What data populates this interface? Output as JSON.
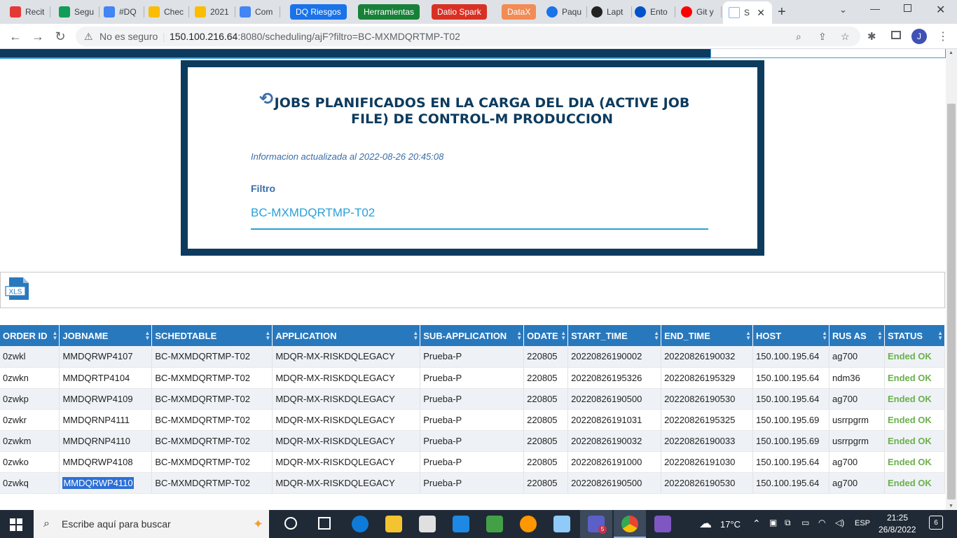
{
  "browser": {
    "tabs": [
      {
        "label": "Recit",
        "icon": "calendar-icon",
        "color": "#e53935"
      },
      {
        "label": "Segu",
        "icon": "sheets-icon",
        "color": "#0f9d58"
      },
      {
        "label": "#DQ",
        "icon": "docs-icon",
        "color": "#4285f4"
      },
      {
        "label": "Chec",
        "icon": "drive-icon",
        "color": "#fbbc04"
      },
      {
        "label": "2021",
        "icon": "drive-icon",
        "color": "#fbbc04"
      },
      {
        "label": "Com",
        "icon": "docs-icon",
        "color": "#4285f4"
      }
    ],
    "bookmarks": [
      {
        "label": "DQ Riesgos",
        "color": "#1a73e8"
      },
      {
        "label": "Herramientas",
        "color": "#188038"
      },
      {
        "label": "Datio Spark",
        "color": "#d93025"
      },
      {
        "label": "DataX",
        "color": "#f28b54"
      }
    ],
    "tabs2": [
      {
        "label": "Paqu",
        "icon": "pin-icon",
        "color": "#1a73e8"
      },
      {
        "label": "Lapt",
        "icon": "circle-icon",
        "color": "#222"
      },
      {
        "label": "Ento",
        "icon": "atlassian-icon",
        "color": "#0052cc"
      },
      {
        "label": "Git y",
        "icon": "youtube-icon",
        "color": "#ff0000"
      }
    ],
    "active_tab": "S",
    "security_label": "No es seguro",
    "url_host": "150.100.216.64",
    "url_rest": ":8080/scheduling/ajF?filtro=BC-MXMDQRTMP-T02",
    "profile_initial": "J"
  },
  "page": {
    "title": "JOBS PLANIFICADOS EN LA CARGA DEL DIA (ACTIVE JOB FILE) DE CONTROL-M PRODUCCION",
    "updated": "Informacion actualizada al 2022-08-26 20:45:08",
    "filter_label": "Filtro",
    "filter_value": "BC-MXMDQRTMP-T02",
    "xls_label": "XLS"
  },
  "table": {
    "columns": [
      "ORDER ID",
      "JOBNAME",
      "SCHEDTABLE",
      "APPLICATION",
      "SUB-APPLICATION",
      "ODATE",
      "START_TIME",
      "END_TIME",
      "HOST",
      "RUS AS",
      "STATUS"
    ],
    "rows": [
      [
        "0zwkl",
        "MMDQRWP4107",
        "BC-MXMDQRTMP-T02",
        "MDQR-MX-RISKDQLEGACY",
        "Prueba-P",
        "220805",
        "20220826190002",
        "20220826190032",
        "150.100.195.64",
        "ag700",
        "Ended OK"
      ],
      [
        "0zwkn",
        "MMDQRTP4104",
        "BC-MXMDQRTMP-T02",
        "MDQR-MX-RISKDQLEGACY",
        "Prueba-P",
        "220805",
        "20220826195326",
        "20220826195329",
        "150.100.195.64",
        "ndm36",
        "Ended OK"
      ],
      [
        "0zwkp",
        "MMDQRWP4109",
        "BC-MXMDQRTMP-T02",
        "MDQR-MX-RISKDQLEGACY",
        "Prueba-P",
        "220805",
        "20220826190500",
        "20220826190530",
        "150.100.195.64",
        "ag700",
        "Ended OK"
      ],
      [
        "0zwkr",
        "MMDQRNP4111",
        "BC-MXMDQRTMP-T02",
        "MDQR-MX-RISKDQLEGACY",
        "Prueba-P",
        "220805",
        "20220826191031",
        "20220826195325",
        "150.100.195.69",
        "usrrpgrm",
        "Ended OK"
      ],
      [
        "0zwkm",
        "MMDQRNP4110",
        "BC-MXMDQRTMP-T02",
        "MDQR-MX-RISKDQLEGACY",
        "Prueba-P",
        "220805",
        "20220826190032",
        "20220826190033",
        "150.100.195.69",
        "usrrpgrm",
        "Ended OK"
      ],
      [
        "0zwko",
        "MMDQRWP4108",
        "BC-MXMDQRTMP-T02",
        "MDQR-MX-RISKDQLEGACY",
        "Prueba-P",
        "220805",
        "20220826191000",
        "20220826191030",
        "150.100.195.64",
        "ag700",
        "Ended OK"
      ],
      [
        "0zwkq",
        "MMDQRWP4110",
        "BC-MXMDQRTMP-T02",
        "MDQR-MX-RISKDQLEGACY",
        "Prueba-P",
        "220805",
        "20220826190500",
        "20220826190530",
        "150.100.195.64",
        "ag700",
        "Ended OK"
      ]
    ],
    "selected_cell": "MMDQRWP4110"
  },
  "taskbar": {
    "search_placeholder": "Escribe aquí para buscar",
    "temperature": "17°C",
    "language": "ESP",
    "time": "21:25",
    "date": "26/8/2022",
    "notifications": "6",
    "teams_badge": "5"
  },
  "colors": {
    "navy": "#0d3b5e",
    "header_blue": "#2878bd",
    "status_green": "#6ab04c"
  }
}
